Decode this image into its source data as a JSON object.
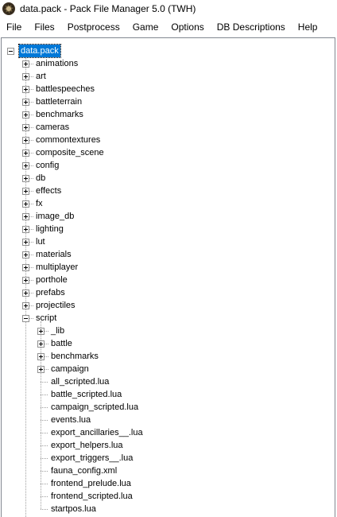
{
  "window": {
    "title": "data.pack - Pack File Manager 5.0 (TWH)",
    "icon": "app-icon"
  },
  "menu": [
    "File",
    "Files",
    "Postprocess",
    "Game",
    "Options",
    "DB Descriptions",
    "Help"
  ],
  "tree": {
    "root": {
      "label": "data.pack",
      "selected": true,
      "expanded": true
    },
    "children": [
      {
        "label": "animations",
        "type": "folder"
      },
      {
        "label": "art",
        "type": "folder"
      },
      {
        "label": "battlespeeches",
        "type": "folder"
      },
      {
        "label": "battleterrain",
        "type": "folder"
      },
      {
        "label": "benchmarks",
        "type": "folder"
      },
      {
        "label": "cameras",
        "type": "folder"
      },
      {
        "label": "commontextures",
        "type": "folder"
      },
      {
        "label": "composite_scene",
        "type": "folder"
      },
      {
        "label": "config",
        "type": "folder"
      },
      {
        "label": "db",
        "type": "folder"
      },
      {
        "label": "effects",
        "type": "folder"
      },
      {
        "label": "fx",
        "type": "folder"
      },
      {
        "label": "image_db",
        "type": "folder"
      },
      {
        "label": "lighting",
        "type": "folder"
      },
      {
        "label": "lut",
        "type": "folder"
      },
      {
        "label": "materials",
        "type": "folder"
      },
      {
        "label": "multiplayer",
        "type": "folder"
      },
      {
        "label": "porthole",
        "type": "folder"
      },
      {
        "label": "prefabs",
        "type": "folder"
      },
      {
        "label": "projectiles",
        "type": "folder"
      },
      {
        "label": "script",
        "type": "folder",
        "expanded": true,
        "children": [
          {
            "label": "_lib",
            "type": "folder"
          },
          {
            "label": "battle",
            "type": "folder"
          },
          {
            "label": "benchmarks",
            "type": "folder"
          },
          {
            "label": "campaign",
            "type": "folder"
          },
          {
            "label": "all_scripted.lua",
            "type": "file"
          },
          {
            "label": "battle_scripted.lua",
            "type": "file"
          },
          {
            "label": "campaign_scripted.lua",
            "type": "file"
          },
          {
            "label": "events.lua",
            "type": "file"
          },
          {
            "label": "export_ancillaries__.lua",
            "type": "file"
          },
          {
            "label": "export_helpers.lua",
            "type": "file"
          },
          {
            "label": "export_triggers__.lua",
            "type": "file"
          },
          {
            "label": "fauna_config.xml",
            "type": "file"
          },
          {
            "label": "frontend_prelude.lua",
            "type": "file"
          },
          {
            "label": "frontend_scripted.lua",
            "type": "file"
          },
          {
            "label": "startpos.lua",
            "type": "file"
          }
        ]
      }
    ]
  }
}
